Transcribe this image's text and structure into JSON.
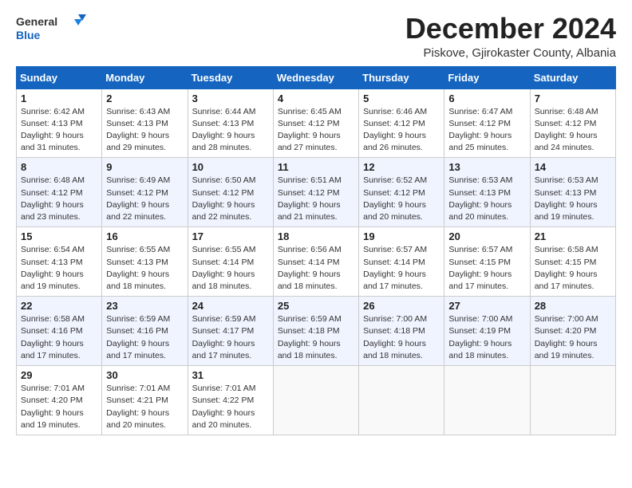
{
  "header": {
    "logo_general": "General",
    "logo_blue": "Blue",
    "month_title": "December 2024",
    "location": "Piskove, Gjirokaster County, Albania"
  },
  "weekdays": [
    "Sunday",
    "Monday",
    "Tuesday",
    "Wednesday",
    "Thursday",
    "Friday",
    "Saturday"
  ],
  "weeks": [
    [
      {
        "day": "1",
        "sunrise": "6:42 AM",
        "sunset": "4:13 PM",
        "daylight": "9 hours and 31 minutes."
      },
      {
        "day": "2",
        "sunrise": "6:43 AM",
        "sunset": "4:13 PM",
        "daylight": "9 hours and 29 minutes."
      },
      {
        "day": "3",
        "sunrise": "6:44 AM",
        "sunset": "4:13 PM",
        "daylight": "9 hours and 28 minutes."
      },
      {
        "day": "4",
        "sunrise": "6:45 AM",
        "sunset": "4:12 PM",
        "daylight": "9 hours and 27 minutes."
      },
      {
        "day": "5",
        "sunrise": "6:46 AM",
        "sunset": "4:12 PM",
        "daylight": "9 hours and 26 minutes."
      },
      {
        "day": "6",
        "sunrise": "6:47 AM",
        "sunset": "4:12 PM",
        "daylight": "9 hours and 25 minutes."
      },
      {
        "day": "7",
        "sunrise": "6:48 AM",
        "sunset": "4:12 PM",
        "daylight": "9 hours and 24 minutes."
      }
    ],
    [
      {
        "day": "8",
        "sunrise": "6:48 AM",
        "sunset": "4:12 PM",
        "daylight": "9 hours and 23 minutes."
      },
      {
        "day": "9",
        "sunrise": "6:49 AM",
        "sunset": "4:12 PM",
        "daylight": "9 hours and 22 minutes."
      },
      {
        "day": "10",
        "sunrise": "6:50 AM",
        "sunset": "4:12 PM",
        "daylight": "9 hours and 22 minutes."
      },
      {
        "day": "11",
        "sunrise": "6:51 AM",
        "sunset": "4:12 PM",
        "daylight": "9 hours and 21 minutes."
      },
      {
        "day": "12",
        "sunrise": "6:52 AM",
        "sunset": "4:12 PM",
        "daylight": "9 hours and 20 minutes."
      },
      {
        "day": "13",
        "sunrise": "6:53 AM",
        "sunset": "4:13 PM",
        "daylight": "9 hours and 20 minutes."
      },
      {
        "day": "14",
        "sunrise": "6:53 AM",
        "sunset": "4:13 PM",
        "daylight": "9 hours and 19 minutes."
      }
    ],
    [
      {
        "day": "15",
        "sunrise": "6:54 AM",
        "sunset": "4:13 PM",
        "daylight": "9 hours and 19 minutes."
      },
      {
        "day": "16",
        "sunrise": "6:55 AM",
        "sunset": "4:13 PM",
        "daylight": "9 hours and 18 minutes."
      },
      {
        "day": "17",
        "sunrise": "6:55 AM",
        "sunset": "4:14 PM",
        "daylight": "9 hours and 18 minutes."
      },
      {
        "day": "18",
        "sunrise": "6:56 AM",
        "sunset": "4:14 PM",
        "daylight": "9 hours and 18 minutes."
      },
      {
        "day": "19",
        "sunrise": "6:57 AM",
        "sunset": "4:14 PM",
        "daylight": "9 hours and 17 minutes."
      },
      {
        "day": "20",
        "sunrise": "6:57 AM",
        "sunset": "4:15 PM",
        "daylight": "9 hours and 17 minutes."
      },
      {
        "day": "21",
        "sunrise": "6:58 AM",
        "sunset": "4:15 PM",
        "daylight": "9 hours and 17 minutes."
      }
    ],
    [
      {
        "day": "22",
        "sunrise": "6:58 AM",
        "sunset": "4:16 PM",
        "daylight": "9 hours and 17 minutes."
      },
      {
        "day": "23",
        "sunrise": "6:59 AM",
        "sunset": "4:16 PM",
        "daylight": "9 hours and 17 minutes."
      },
      {
        "day": "24",
        "sunrise": "6:59 AM",
        "sunset": "4:17 PM",
        "daylight": "9 hours and 17 minutes."
      },
      {
        "day": "25",
        "sunrise": "6:59 AM",
        "sunset": "4:18 PM",
        "daylight": "9 hours and 18 minutes."
      },
      {
        "day": "26",
        "sunrise": "7:00 AM",
        "sunset": "4:18 PM",
        "daylight": "9 hours and 18 minutes."
      },
      {
        "day": "27",
        "sunrise": "7:00 AM",
        "sunset": "4:19 PM",
        "daylight": "9 hours and 18 minutes."
      },
      {
        "day": "28",
        "sunrise": "7:00 AM",
        "sunset": "4:20 PM",
        "daylight": "9 hours and 19 minutes."
      }
    ],
    [
      {
        "day": "29",
        "sunrise": "7:01 AM",
        "sunset": "4:20 PM",
        "daylight": "9 hours and 19 minutes."
      },
      {
        "day": "30",
        "sunrise": "7:01 AM",
        "sunset": "4:21 PM",
        "daylight": "9 hours and 20 minutes."
      },
      {
        "day": "31",
        "sunrise": "7:01 AM",
        "sunset": "4:22 PM",
        "daylight": "9 hours and 20 minutes."
      },
      null,
      null,
      null,
      null
    ]
  ],
  "labels": {
    "sunrise": "Sunrise:",
    "sunset": "Sunset:",
    "daylight": "Daylight:"
  }
}
